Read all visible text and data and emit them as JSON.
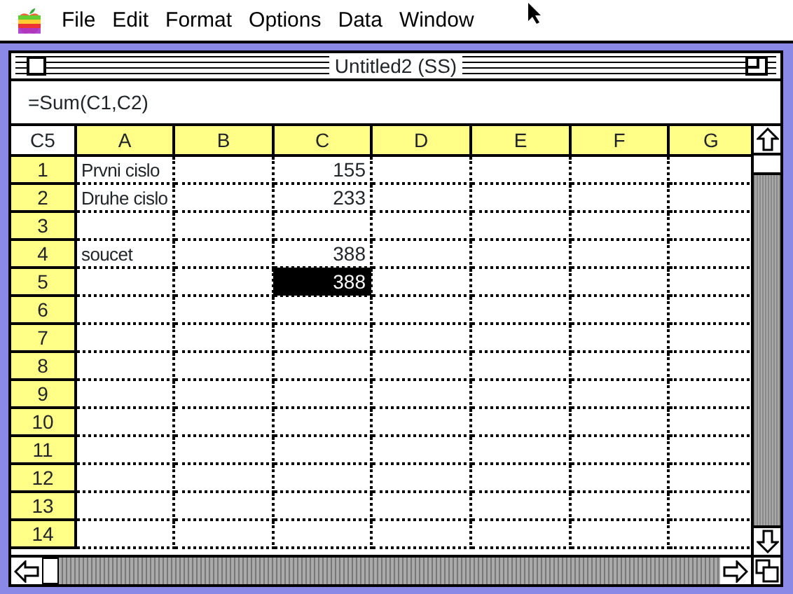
{
  "menu_bar": {
    "items": [
      "File",
      "Edit",
      "Format",
      "Options",
      "Data",
      "Window"
    ]
  },
  "window": {
    "title": "Untitled2 (SS)"
  },
  "formula_bar": {
    "value": "=Sum(C1,C2)"
  },
  "sheet": {
    "name_box": "C5",
    "columns": [
      "A",
      "B",
      "C",
      "D",
      "E",
      "F",
      "G"
    ],
    "rows": [
      {
        "label": "1",
        "cells": [
          {
            "text": "Prvni cislo",
            "kind": "text",
            "selected": false
          },
          {
            "text": "",
            "kind": "empty",
            "selected": false
          },
          {
            "text": "155",
            "kind": "number",
            "selected": false
          }
        ]
      },
      {
        "label": "2",
        "cells": [
          {
            "text": "Druhe cislo",
            "kind": "text",
            "selected": false
          },
          {
            "text": "",
            "kind": "empty",
            "selected": false
          },
          {
            "text": "233",
            "kind": "number",
            "selected": false
          }
        ]
      },
      {
        "label": "3",
        "cells": []
      },
      {
        "label": "4",
        "cells": [
          {
            "text": "soucet",
            "kind": "text",
            "selected": false
          },
          {
            "text": "",
            "kind": "empty",
            "selected": false
          },
          {
            "text": "388",
            "kind": "number",
            "selected": false
          }
        ]
      },
      {
        "label": "5",
        "cells": [
          {
            "text": "",
            "kind": "empty",
            "selected": false
          },
          {
            "text": "",
            "kind": "empty",
            "selected": false
          },
          {
            "text": "388",
            "kind": "number",
            "selected": true
          }
        ]
      },
      {
        "label": "6",
        "cells": []
      },
      {
        "label": "7",
        "cells": []
      },
      {
        "label": "8",
        "cells": []
      },
      {
        "label": "9",
        "cells": []
      },
      {
        "label": "10",
        "cells": []
      },
      {
        "label": "11",
        "cells": []
      },
      {
        "label": "12",
        "cells": []
      },
      {
        "label": "13",
        "cells": []
      },
      {
        "label": "14",
        "cells": []
      }
    ]
  }
}
